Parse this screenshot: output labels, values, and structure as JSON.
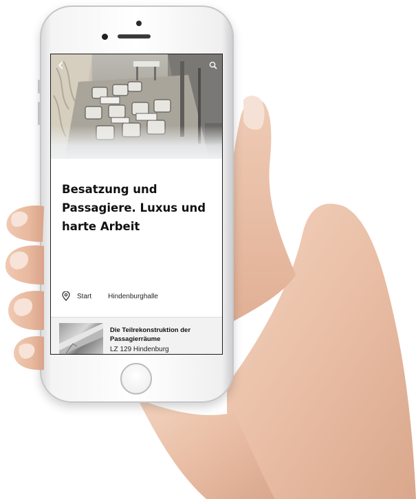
{
  "article": {
    "title": "Besatzung und Passagiere. Luxus und harte Arbeit",
    "meta": {
      "location_icon": "map-pin-icon",
      "start_label": "Start",
      "hall_label": "Hindenburghalle"
    }
  },
  "header": {
    "back_icon": "back-arrow-icon",
    "search_icon": "search-icon"
  },
  "next_card": {
    "title": "Die Teilrekonstruktion der Passagierräume",
    "subtitle": "LZ 129 Hindenburg"
  },
  "colors": {
    "text": "#111111",
    "card_background": "#f2f2f2",
    "phone_frame": "#f4f4f5"
  }
}
